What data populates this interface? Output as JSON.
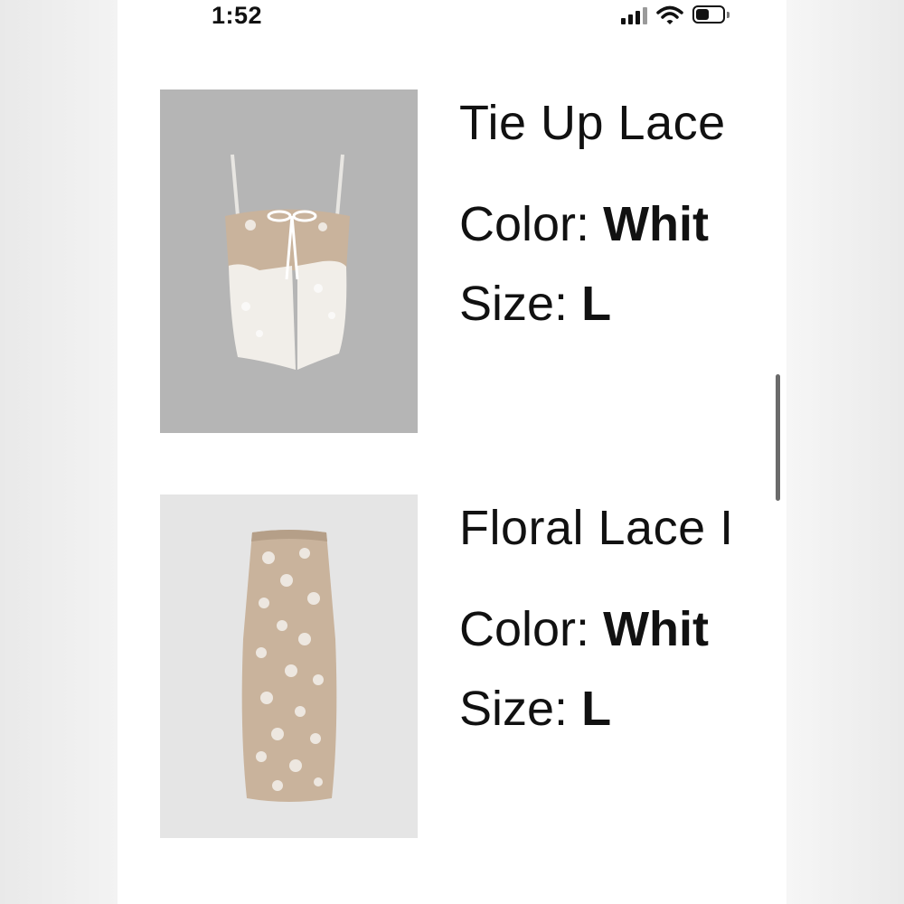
{
  "status_bar": {
    "time": "1:52",
    "icons": [
      "signal-icon",
      "wifi-icon",
      "battery-icon"
    ]
  },
  "items": [
    {
      "title": "Tie Up Lace",
      "color_label": "Color:",
      "color_value": "Whit",
      "size_label": "Size:",
      "size_value": "L",
      "image": "lace-camisole-top-image"
    },
    {
      "title": "Floral Lace I",
      "color_label": "Color:",
      "color_value": "Whit",
      "size_label": "Size:",
      "size_value": "L",
      "image": "floral-lace-maxi-skirt-image"
    }
  ],
  "colors": {
    "thumb_bg_1": "#b5b5b5",
    "thumb_bg_2": "#e5e5e5",
    "text": "#111111",
    "garment_beige": "#c9b39c",
    "lace_white": "#f4f1ec"
  }
}
